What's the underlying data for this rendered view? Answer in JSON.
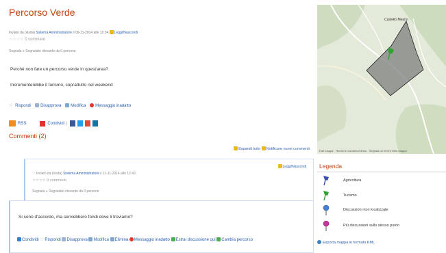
{
  "post": {
    "title": "Percorso Verde",
    "meta_prefix": "Inviato da (visita)",
    "author": "Sistema Amministratore",
    "meta_date": "il 09-11-2014 alle 12:34",
    "read_unread": "Leggi/Nascondi",
    "comments_count": "0 comment",
    "flags_prefix": "Segnala",
    "flags_text": "Segnalato rilevante da 0 persone",
    "line1": "Perchè non fare un percorso verde in quest'area?",
    "line2": "Incrementerebbe il turismo, soprattutto nel weekend",
    "actions": [
      "Rispondi",
      "Disapprova",
      "Modifica",
      "Messaggio inadatto"
    ]
  },
  "share": {
    "rss": "RSS",
    "condividi": "Condividi"
  },
  "comments": {
    "heading": "Commenti (2)",
    "toolbar": [
      "Espandi tutto",
      "Notificare nuovi commenti"
    ],
    "comment1": {
      "reply_link": "Leggi/Nascondi",
      "meta_prefix": "Inviato da (visita)",
      "author": "Sistema Amministratore",
      "meta_date": "il 11-11-2014 alle 12:43",
      "count": "0 commenti",
      "flags_prefix": "Segnala",
      "flags_text": "Segnalato rilevante da 0 persone"
    },
    "comment2": {
      "text": "Si sono d'accordo, ma serviebbero fondi dove li troviamo?",
      "actions": [
        "Condividi",
        "Rispondi",
        "Disapprova",
        "Modifica",
        "Elimina",
        "Messaggio inadatto",
        "Estrai discussione qui",
        "Cambia percorso"
      ]
    }
  },
  "map": {
    "place_label": "Castello Meano",
    "footer": [
      "Dati mappa",
      "Termini e condizioni d'uso",
      "Segnala un errore nella mappa"
    ]
  },
  "legend": {
    "title": "Legenda",
    "items": [
      {
        "label": "Agricoltura",
        "color": "#3b4fb5"
      },
      {
        "label": "Turismo",
        "color": "#2ea42e"
      },
      {
        "label": "Discussioni non localizzate",
        "color": "#4a7fd0"
      },
      {
        "label": "Più discussioni sullo stesso punto",
        "color": "#c2399b"
      }
    ],
    "kml": "Esporta mappa in formato KML"
  }
}
